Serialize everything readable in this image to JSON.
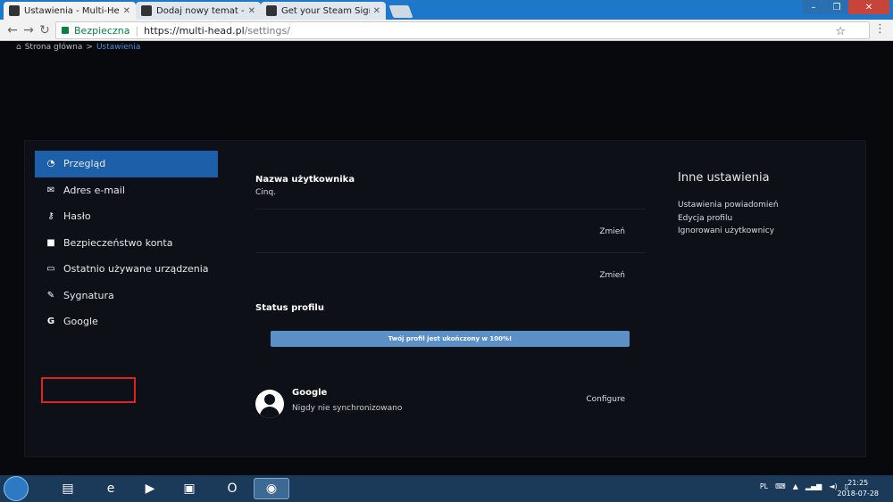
{
  "browser": {
    "tabs": [
      {
        "title": "Ustawienia - Multi-Head"
      },
      {
        "title": "Dodaj nowy temat - Multi"
      },
      {
        "title": "Get your Steam Signatur"
      }
    ],
    "address": {
      "secure_label": "Bezpieczna",
      "url_host": "https://multi-head.pl",
      "url_path": "/settings/"
    }
  },
  "breadcrumb": {
    "home": "Strona główna",
    "separator": ">",
    "current": "Ustawienia"
  },
  "sidebar": {
    "items": [
      {
        "label": "Przegląd",
        "icon": "dashboard-icon"
      },
      {
        "label": "Adres e-mail",
        "icon": "envelope-icon"
      },
      {
        "label": "Hasło",
        "icon": "key-icon"
      },
      {
        "label": "Bezpieczeństwo konta",
        "icon": "lock-icon"
      },
      {
        "label": "Ostatnio używane urządzenia",
        "icon": "laptop-icon"
      },
      {
        "label": "Sygnatura",
        "icon": "pencil-icon"
      },
      {
        "label": "Google",
        "icon": "google-icon"
      }
    ]
  },
  "main": {
    "username_label": "Nazwa użytkownika",
    "username_value": "Cinq.",
    "change_label_1": "Zmień",
    "change_label_2": "Zmień",
    "status_label": "Status profilu",
    "progress_text": "Twój profil jest ukończony w 100%!",
    "progress_value": 1.0
  },
  "google_connection": {
    "title": "Google",
    "subtitle": "Nigdy nie synchronizowano",
    "action": "Configure"
  },
  "other_settings": {
    "title": "Inne ustawienia",
    "links": [
      "Ustawienia powiadomień",
      "Edycja profilu",
      "Ignorowani użytkownicy"
    ]
  },
  "taskbar": {
    "language": "PL",
    "time": "21:25",
    "date": "2018-07-28"
  },
  "colors": {
    "accent": "#1d5fa8",
    "highlight": "#dd2222",
    "progress": "#5a8fc8"
  }
}
